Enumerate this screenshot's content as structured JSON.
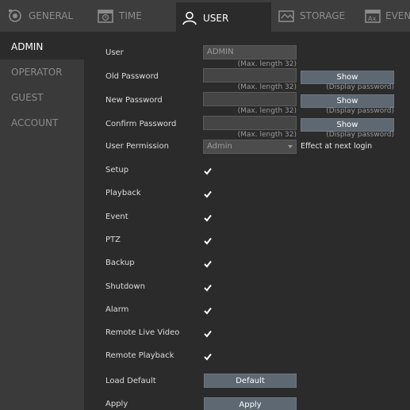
{
  "tabs": [
    {
      "label": "GENERAL",
      "icon": "camera-icon"
    },
    {
      "label": "TIME",
      "icon": "clock-calendar-icon"
    },
    {
      "label": "USER",
      "icon": "user-icon"
    },
    {
      "label": "STORAGE",
      "icon": "storage-icon"
    },
    {
      "label": "EVENT",
      "icon": "event-icon"
    }
  ],
  "active_tab": "USER",
  "sidebar": {
    "items": [
      {
        "label": "ADMIN"
      },
      {
        "label": "OPERATOR"
      },
      {
        "label": "GUEST"
      },
      {
        "label": "ACCOUNT"
      }
    ],
    "active": "ADMIN"
  },
  "form": {
    "user": {
      "label": "User",
      "value": "ADMIN",
      "hint": "(Max. length 32)"
    },
    "old_password": {
      "label": "Old Password",
      "value": "",
      "hint": "(Max. length 32)",
      "show_label": "Show",
      "show_hint": "(Display password)"
    },
    "new_password": {
      "label": "New Password",
      "value": "",
      "hint": "(Max. length 32)",
      "show_label": "Show",
      "show_hint": "(Display password)"
    },
    "confirm_password": {
      "label": "Confirm Password",
      "value": "",
      "hint": "(Max. length 32)",
      "show_label": "Show",
      "show_hint": "(Display password)"
    },
    "permission": {
      "label": "User Permission",
      "value": "Admin",
      "note": "Effect at next login"
    },
    "permissions": [
      {
        "label": "Setup",
        "checked": true
      },
      {
        "label": "Playback",
        "checked": true
      },
      {
        "label": "Event",
        "checked": true
      },
      {
        "label": "PTZ",
        "checked": true
      },
      {
        "label": "Backup",
        "checked": true
      },
      {
        "label": "Shutdown",
        "checked": true
      },
      {
        "label": "Alarm",
        "checked": true
      },
      {
        "label": "Remote Live Video",
        "checked": true
      },
      {
        "label": "Remote Playback",
        "checked": true
      }
    ],
    "load_default": {
      "label": "Load Default",
      "button": "Default"
    },
    "apply": {
      "label": "Apply",
      "button": "Apply"
    }
  },
  "colors": {
    "background": "#2b2b2b",
    "tabbar": "#3d3d3d",
    "sidebar": "#3a3a3a",
    "button": "#5d6873"
  }
}
